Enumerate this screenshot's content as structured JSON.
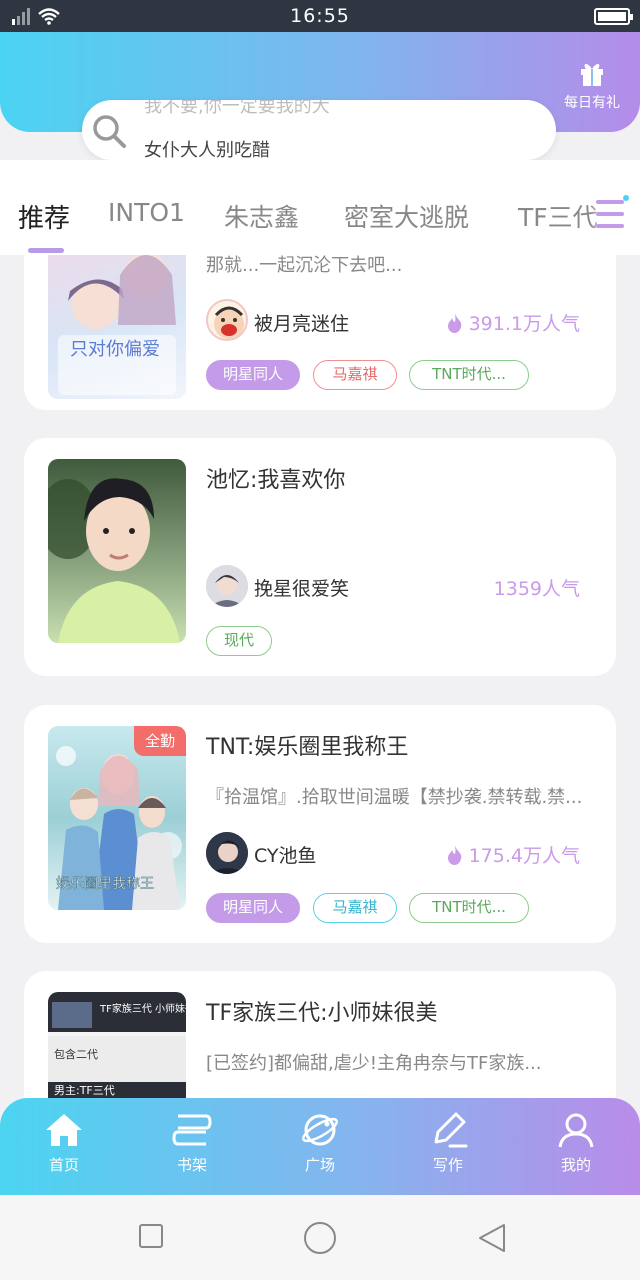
{
  "status_bar": {
    "time": "16:55"
  },
  "header": {
    "gift_label": "每日有礼",
    "search": {
      "ghost_text": "我不要,你一定要我的大",
      "placeholder": "女仆大人别吃醋"
    }
  },
  "tabs": [
    {
      "label": "推荐"
    },
    {
      "label": "INTO1"
    },
    {
      "label": "朱志鑫"
    },
    {
      "label": "密室大逃脱"
    },
    {
      "label": "TF三代"
    }
  ],
  "books": [
    {
      "title": "",
      "desc": "那就...一起沉沦下去吧...",
      "author": "被月亮迷住",
      "popularity": "391.1万人气",
      "tags": [
        "明星同人",
        "马嘉祺",
        "TNT时代..."
      ],
      "cover_text": "只对你偏爱"
    },
    {
      "title": "池忆:我喜欢你",
      "desc": "",
      "author": "挽星很爱笑",
      "popularity": "1359人气",
      "tags": [
        "现代"
      ]
    },
    {
      "title": "TNT:娱乐圈里我称王",
      "desc": "『拾温馆』.拾取世间温暖【禁抄袭.禁转载.禁...",
      "author": "CY池鱼",
      "popularity": "175.4万人气",
      "tags": [
        "明星同人",
        "马嘉祺",
        "TNT时代..."
      ],
      "badge": "全勤",
      "cover_text": "娱乐圈里我称王"
    },
    {
      "title": "TF家族三代:小师妹很美",
      "desc": "[已签约]都偏甜,虐少!主角冉奈与TF家族...",
      "cover_title": "TF家族三代 小师妹很美",
      "cover_tag1": "包含二代",
      "cover_tag2": "男主:TF三代"
    }
  ],
  "bottom_nav": [
    {
      "label": "首页",
      "icon": "home-icon"
    },
    {
      "label": "书架",
      "icon": "bookshelf-icon"
    },
    {
      "label": "广场",
      "icon": "planet-icon"
    },
    {
      "label": "写作",
      "icon": "pen-icon"
    },
    {
      "label": "我的",
      "icon": "user-icon"
    }
  ],
  "colors": {
    "accent": "#b89be8",
    "gradient_start": "#4bd3f2",
    "gradient_end": "#b58ce9",
    "badge": "#f36d6a",
    "popularity": "#c99be9"
  }
}
